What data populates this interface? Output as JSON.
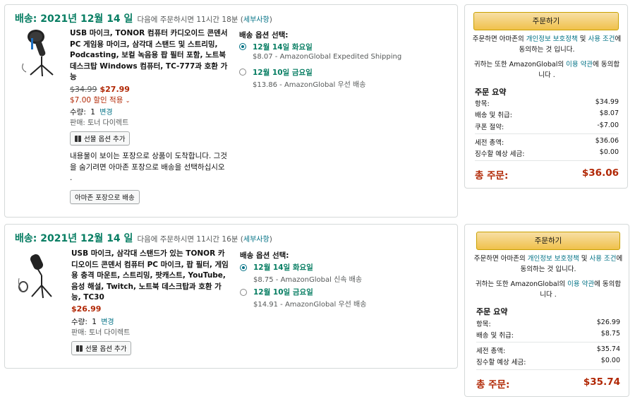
{
  "shipments": [
    {
      "header": {
        "date": "배송: 2021년 12월  14 일",
        "note": "다음에 주문하시면 11시간 18분 (",
        "details": "세부사항",
        "close": ")"
      },
      "product": {
        "title": "USB 마이크, TONOR 컴퓨터 카디오이드 콘덴서 PC 게임용 마이크, 삼각대 스탠드 및 스트리밍, Podcasting, 보컬 녹음용 팝 필터 포함, 노트북 데스크탑 Windows 컴퓨터, TC-777과 호환 가능",
        "list_price": "$34.99",
        "price": "$27.99",
        "discount": "$7.00 할인 적용",
        "qty_label": "수량:",
        "qty": "1",
        "qty_change": "변경",
        "seller": "판매: 토너 다이렉트",
        "gift_button": "선물 옵션 추가",
        "package_note": "내용물이 보이는 포장으로 상품이 도착합니다. 그것을 숨기려면 아마존 포장으로 배송을 선택하십시오 .",
        "package_button": "아마존 포장으로 배송"
      },
      "options": {
        "title": "배송 옵션 선택:",
        "items": [
          {
            "date": "12월 14일 화요일",
            "desc": "$8.07 - AmazonGlobal Expedited Shipping",
            "selected": true
          },
          {
            "date": "12월 10일 금요일",
            "desc": "$13.86 - AmazonGlobal 우선 배송",
            "selected": false
          }
        ]
      },
      "order": {
        "button": "주문하기",
        "agree_pre": "주문하면 아마존의 ",
        "privacy": "개인정보 보호정책",
        "agree_mid": " 및 ",
        "terms": "사용 조건",
        "agree_post": "에 동의하는 것 입니다.",
        "also_pre": "귀하는 또한 AmazonGlobal의 ",
        "also_link": "이용 약관",
        "also_post": "에 동의합니다 .",
        "summary_title": "주문 요약",
        "rows": [
          {
            "label": "항목:",
            "value": "$34.99"
          },
          {
            "label": "배송 및 취급:",
            "value": "$8.07"
          },
          {
            "label": "쿠폰 절약:",
            "value": "-$7.00"
          },
          {
            "label": "세전 총액:",
            "value": "$36.06"
          },
          {
            "label": "징수할 예상 세금:",
            "value": "$0.00"
          }
        ],
        "total_label": "총 주문:",
        "total_value": "$36.06"
      }
    },
    {
      "header": {
        "date": "배송: 2021년 12월  14 일",
        "note": "다음에 주문하시면 11시간 16분 (",
        "details": "세부사항",
        "close": ")"
      },
      "product": {
        "title": "USB 마이크, 삼각대 스탠드가 있는 TONOR 카디오이드 콘덴서 컴퓨터 PC 마이크, 팝 필터, 게임용 충격 마운트, 스트리밍, 팟캐스트, YouTube, 음성 해설, Twitch, 노트북 데스크탑과 호환 가능, TC30",
        "price": "$26.99",
        "qty_label": "수량:",
        "qty": "1",
        "qty_change": "변경",
        "seller": "판매: 토너 다이렉트",
        "gift_button": "선물 옵션 추가"
      },
      "options": {
        "title": "배송 옵션 선택:",
        "items": [
          {
            "date": "12월 14일 화요일",
            "desc": "$8.75 - AmazonGlobal 신속 배송",
            "selected": true
          },
          {
            "date": "12월 10일 금요일",
            "desc": "$14.91 - AmazonGlobal 우선 배송",
            "selected": false
          }
        ]
      },
      "order": {
        "button": "주문하기",
        "agree_pre": "주문하면 아마존의 ",
        "privacy": "개인정보 보호정책",
        "agree_mid": " 및 ",
        "terms": "사용 조건",
        "agree_post": "에 동의하는 것 입니다.",
        "also_pre": "귀하는 또한 AmazonGlobal의 ",
        "also_link": "이용 약관",
        "also_post": "에 동의합니다 .",
        "summary_title": "주문 요약",
        "rows": [
          {
            "label": "항목:",
            "value": "$26.99"
          },
          {
            "label": "배송 및 취급:",
            "value": "$8.75"
          },
          {
            "label": "세전 총액:",
            "value": "$35.74"
          },
          {
            "label": "징수할 예상 세금:",
            "value": "$0.00"
          }
        ],
        "total_label": "총 주문:",
        "total_value": "$35.74"
      }
    }
  ],
  "colors": {
    "green": "#067d62",
    "price_red": "#b12704",
    "link": "#007185",
    "button_yellow": "#f0c14b"
  }
}
